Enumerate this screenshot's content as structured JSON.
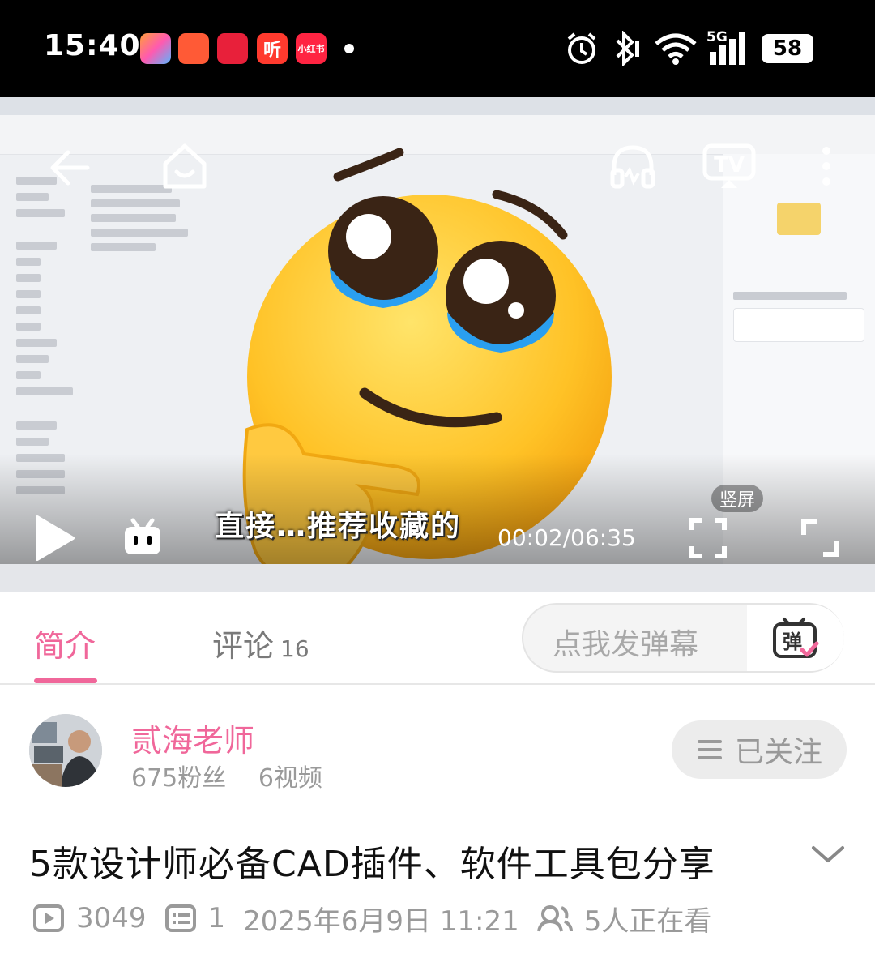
{
  "status_bar": {
    "time": "15:40",
    "apps": [
      {
        "name": "app-1",
        "color": "#f4a340",
        "label": ""
      },
      {
        "name": "app-2",
        "color": "#ff5a36",
        "label": ""
      },
      {
        "name": "app-3",
        "color": "#e8203a",
        "label": ""
      },
      {
        "name": "app-4",
        "color": "#ff3a2e",
        "label": "听"
      },
      {
        "name": "app-5",
        "color": "#ff2442",
        "label": "小红书"
      }
    ],
    "network": "5G",
    "battery": "58"
  },
  "player": {
    "subtitle": "直接…推荐收藏的",
    "timecode": "00:02/06:35",
    "portrait_badge": "竖屏"
  },
  "tabs": {
    "intro": "简介",
    "comments": "评论",
    "comments_count": "16"
  },
  "danmaku": {
    "placeholder": "点我发弹幕",
    "button_label": "弹"
  },
  "uploader": {
    "name": "贰海老师",
    "fans": "675粉丝",
    "videos": "6视频",
    "follow_label": "已关注"
  },
  "video": {
    "title": "5款设计师必备CAD插件、软件工具包分享",
    "plays": "3049",
    "danmaku_count": "1",
    "date": "2025年6月9日 11:21",
    "watching": "5人正在看"
  },
  "colors": {
    "accent": "#f0679a",
    "text": "#111111",
    "muted": "#9a9a9a"
  }
}
